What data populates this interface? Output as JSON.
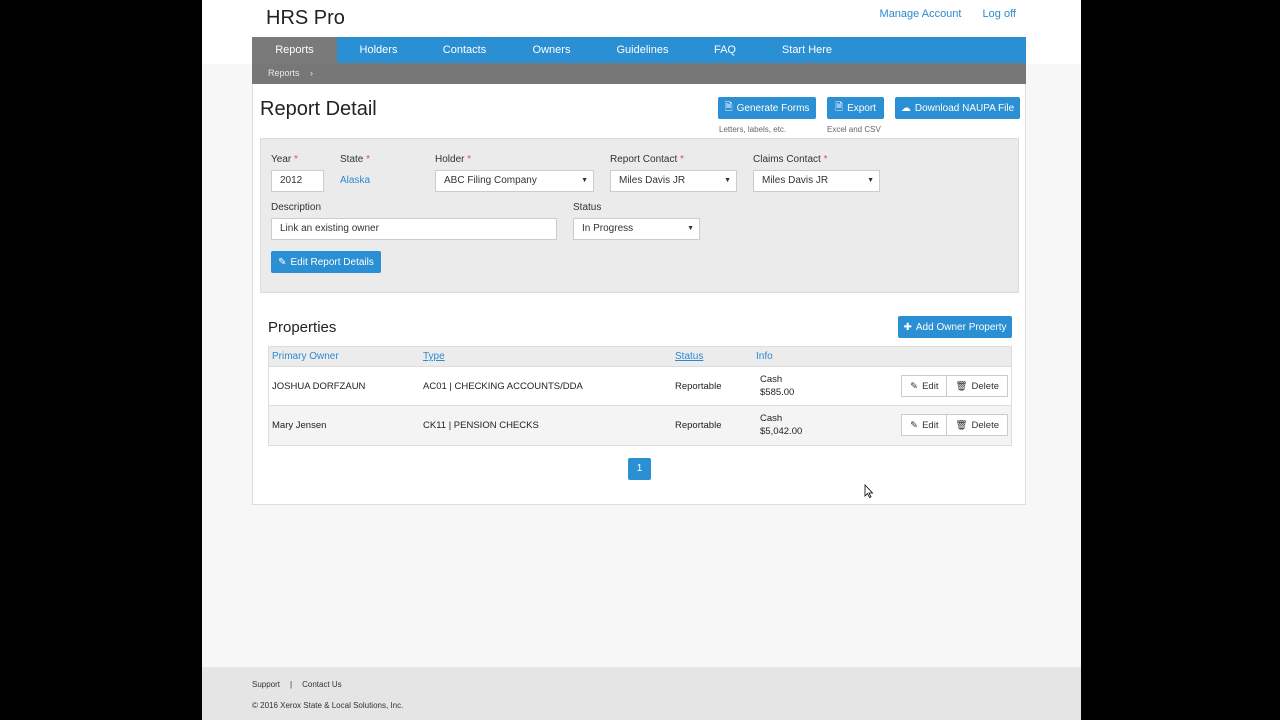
{
  "app": {
    "brand": "HRS Pro",
    "manage_account": "Manage Account",
    "log_off": "Log off"
  },
  "nav": [
    "Reports",
    "Holders",
    "Contacts",
    "Owners",
    "Guidelines",
    "FAQ",
    "Start Here"
  ],
  "breadcrumb": {
    "item": "Reports",
    "sep": "›"
  },
  "page": {
    "title": "Report Detail"
  },
  "actions": {
    "generate_forms": "Generate Forms",
    "generate_hint": "Letters, labels, etc.",
    "export": "Export",
    "export_hint": "Excel and CSV",
    "download": "Download NAUPA File"
  },
  "form": {
    "year_label": "Year",
    "year_value": "2012",
    "state_label": "State",
    "state_value": "Alaska",
    "holder_label": "Holder",
    "holder_value": "ABC Filing Company",
    "report_contact_label": "Report Contact",
    "report_contact_value": "Miles Davis JR",
    "claims_contact_label": "Claims Contact",
    "claims_contact_value": "Miles Davis JR",
    "description_label": "Description",
    "description_value": "Link an existing owner",
    "status_label": "Status",
    "status_value": "In Progress",
    "required_mark": "*",
    "edit_button": "Edit Report Details"
  },
  "properties": {
    "title": "Properties",
    "add_button": "Add Owner Property",
    "headers": {
      "owner": "Primary Owner",
      "type": "Type",
      "status": "Status",
      "info": "Info"
    },
    "rows": [
      {
        "owner": "JOSHUA DORFZAUN",
        "type": "AC01 | CHECKING ACCOUNTS/DDA",
        "status": "Reportable",
        "info1": "Cash",
        "info2": "$585.00"
      },
      {
        "owner": "Mary Jensen",
        "type": "CK11 | PENSION CHECKS",
        "status": "Reportable",
        "info1": "Cash",
        "info2": "$5,042.00"
      }
    ],
    "edit_label": "Edit",
    "delete_label": "Delete",
    "page": "1"
  },
  "footer": {
    "support": "Support",
    "divider": "|",
    "contact": "Contact Us",
    "copyright": "© 2016 Xerox State & Local Solutions, Inc."
  }
}
